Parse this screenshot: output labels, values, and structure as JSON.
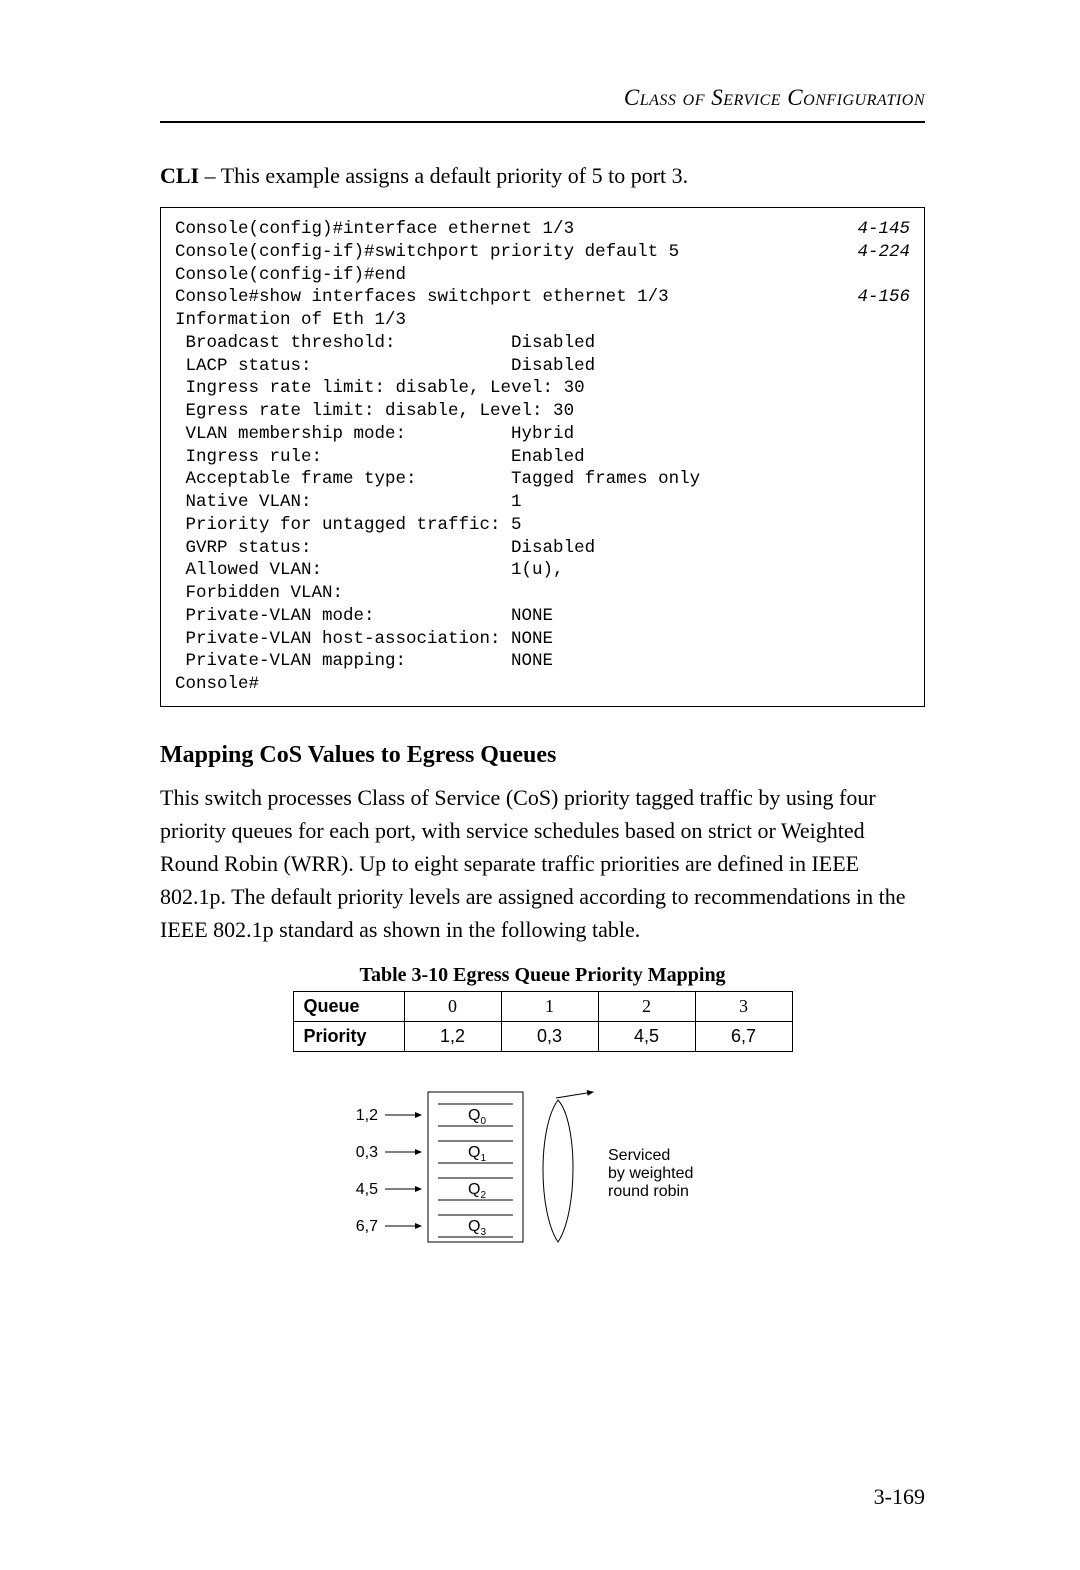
{
  "header": {
    "running_head": "Class of Service Configuration"
  },
  "cli_intro": {
    "lead": "CLI",
    "rest": " – This example assigns a default priority of 5 to port 3."
  },
  "cli": {
    "lines": [
      {
        "text": "Console(config)#interface ethernet 1/3",
        "ref": "4-145"
      },
      {
        "text": "Console(config-if)#switchport priority default 5",
        "ref": "4-224"
      },
      {
        "text": "Console(config-if)#end",
        "ref": ""
      },
      {
        "text": "Console#show interfaces switchport ethernet 1/3",
        "ref": "4-156"
      },
      {
        "text": "Information of Eth 1/3",
        "ref": ""
      },
      {
        "text": " Broadcast threshold:           Disabled",
        "ref": ""
      },
      {
        "text": " LACP status:                   Disabled",
        "ref": ""
      },
      {
        "text": " Ingress rate limit: disable, Level: 30",
        "ref": ""
      },
      {
        "text": " Egress rate limit: disable, Level: 30",
        "ref": ""
      },
      {
        "text": " VLAN membership mode:          Hybrid",
        "ref": ""
      },
      {
        "text": " Ingress rule:                  Enabled",
        "ref": ""
      },
      {
        "text": " Acceptable frame type:         Tagged frames only",
        "ref": ""
      },
      {
        "text": " Native VLAN:                   1",
        "ref": ""
      },
      {
        "text": " Priority for untagged traffic: 5",
        "ref": ""
      },
      {
        "text": " GVRP status:                   Disabled",
        "ref": ""
      },
      {
        "text": " Allowed VLAN:                  1(u),",
        "ref": ""
      },
      {
        "text": " Forbidden VLAN:                ",
        "ref": ""
      },
      {
        "text": " Private-VLAN mode:             NONE",
        "ref": ""
      },
      {
        "text": " Private-VLAN host-association: NONE",
        "ref": ""
      },
      {
        "text": " Private-VLAN mapping:          NONE",
        "ref": ""
      },
      {
        "text": "Console#",
        "ref": ""
      }
    ]
  },
  "section": {
    "heading": "Mapping CoS Values to Egress Queues",
    "paragraph": "This switch processes Class of Service (CoS) priority tagged traffic by using four priority queues for each port, with service schedules based on strict or Weighted Round Robin (WRR). Up to eight separate traffic priorities are defined in IEEE 802.1p. The default priority levels are assigned according to recommendations in the IEEE 802.1p standard as shown in the following table."
  },
  "table": {
    "caption": "Table 3-10  Egress Queue Priority Mapping",
    "rows": [
      {
        "label": "Queue",
        "cells": [
          "0",
          "1",
          "2",
          "3"
        ]
      },
      {
        "label": "Priority",
        "cells": [
          "1,2",
          "0,3",
          "4,5",
          "6,7"
        ]
      }
    ]
  },
  "diagram": {
    "inputs": [
      "1,2",
      "0,3",
      "4,5",
      "6,7"
    ],
    "queues": [
      "Q",
      "Q",
      "Q",
      "Q"
    ],
    "queue_sub": [
      "0",
      "1",
      "2",
      "3"
    ],
    "caption": "Serviced\nby weighted\nround robin"
  },
  "chart_data": {
    "type": "table",
    "title": "Egress Queue Priority Mapping",
    "columns": [
      "Queue",
      "Priority"
    ],
    "rows": [
      {
        "Queue": 0,
        "Priority": "1,2"
      },
      {
        "Queue": 1,
        "Priority": "0,3"
      },
      {
        "Queue": 2,
        "Priority": "4,5"
      },
      {
        "Queue": 3,
        "Priority": "6,7"
      }
    ],
    "diagram": {
      "nodes": [
        {
          "id": "Q0",
          "priorities": [
            1,
            2
          ]
        },
        {
          "id": "Q1",
          "priorities": [
            0,
            3
          ]
        },
        {
          "id": "Q2",
          "priorities": [
            4,
            5
          ]
        },
        {
          "id": "Q3",
          "priorities": [
            6,
            7
          ]
        }
      ],
      "scheduling": "weighted round robin"
    }
  },
  "page_number": "3-169"
}
